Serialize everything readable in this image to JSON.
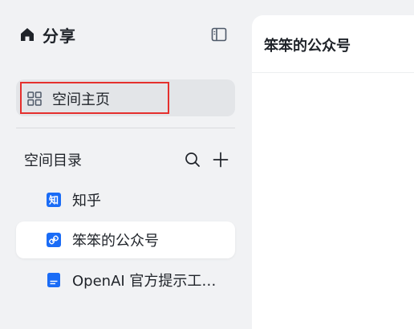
{
  "sidebar": {
    "title": "分享",
    "home_label": "空间主页",
    "catalog_title": "空间目录",
    "items": [
      {
        "label": "知乎",
        "icon": "zhihu-icon",
        "active": false
      },
      {
        "label": "笨笨的公众号",
        "icon": "link-doc-icon",
        "active": true
      },
      {
        "label": "OpenAI 官方提示工程...",
        "icon": "doc-icon",
        "active": false
      }
    ]
  },
  "main": {
    "title": "笨笨的公众号"
  },
  "colors": {
    "accent": "#1a6cf6",
    "highlight_border": "#e5302d"
  }
}
